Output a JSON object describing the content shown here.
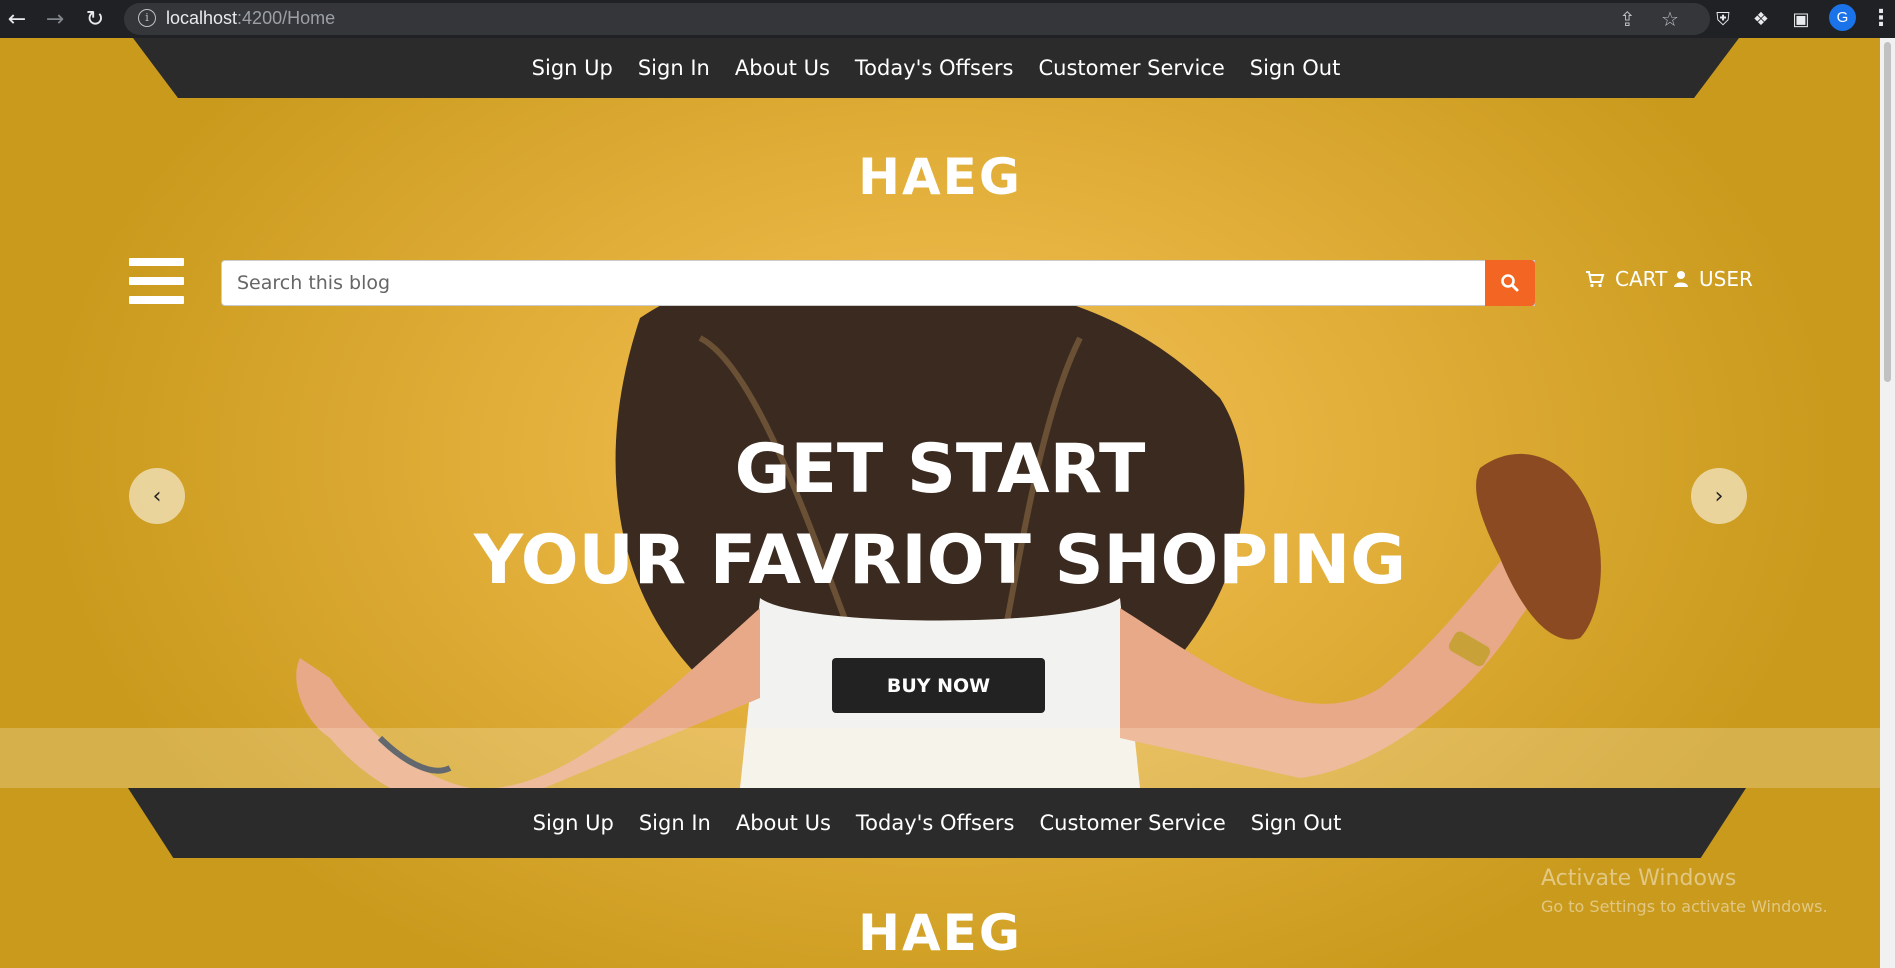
{
  "browser": {
    "url_host": "localhost",
    "url_path": ":4200/Home",
    "profile_initial": "G"
  },
  "nav": {
    "items": [
      "Sign Up",
      "Sign In",
      "About Us",
      "Today's Offsers",
      "Customer Service",
      "Sign Out"
    ]
  },
  "brand": {
    "logo": "HAEG"
  },
  "header": {
    "search_placeholder": "Search this blog",
    "cart_label": "CART",
    "user_label": "USER"
  },
  "hero": {
    "title_line1": "GET START",
    "title_line2": "YOUR FAVRIOT SHOPING",
    "cta_label": "BUY NOW"
  },
  "watermark": {
    "line1": "Activate Windows",
    "line2": "Go to Settings to activate Windows."
  },
  "colors": {
    "background": "#e6b23f",
    "nav_bar": "#2b2b2b",
    "search_button": "#f26522",
    "cta": "#222222"
  }
}
